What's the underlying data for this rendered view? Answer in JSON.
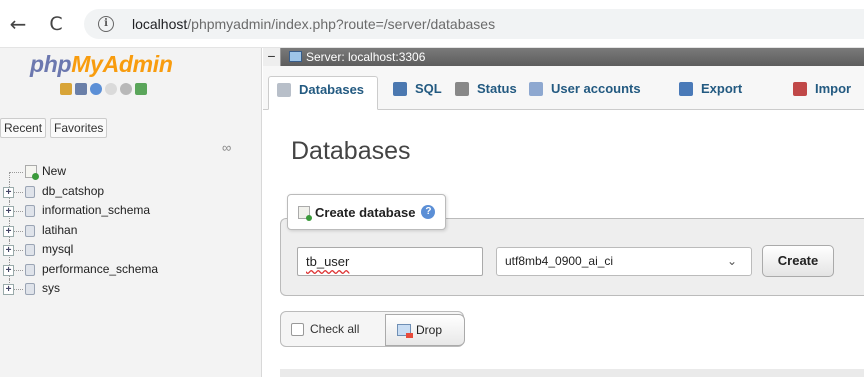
{
  "browser": {
    "back_glyph": "←",
    "reload_glyph": "C",
    "info_glyph": "i",
    "url_host": "localhost",
    "url_path": "/phpmyadmin/index.php?route=/server/databases"
  },
  "sidebar": {
    "logo_part1": "php",
    "logo_part2": "MyAdmin",
    "tabs": [
      "Recent",
      "Favorites"
    ],
    "link_glyph": "∞",
    "new_label": "New",
    "databases": [
      "db_catshop",
      "information_schema",
      "latihan",
      "mysql",
      "performance_schema",
      "sys"
    ],
    "expand_glyph": "+"
  },
  "server_bar": {
    "collapse_glyph": "−",
    "label": "Server: localhost:3306"
  },
  "menu": {
    "items": [
      {
        "label": "Databases",
        "icon": "database-icon",
        "color": "#9aa"
      },
      {
        "label": "SQL",
        "icon": "sql-icon",
        "color": "#4b78b0"
      },
      {
        "label": "Status",
        "icon": "status-icon",
        "color": "#777"
      },
      {
        "label": "User accounts",
        "icon": "users-icon",
        "color": "#6b8cc0"
      },
      {
        "label": "Export",
        "icon": "export-icon",
        "color": "#4a7ab8"
      },
      {
        "label": "Impor",
        "icon": "import-icon",
        "color": "#c04848"
      }
    ]
  },
  "page": {
    "title": "Databases"
  },
  "create": {
    "legend": "Create database",
    "help_glyph": "?",
    "db_name_value": "tb_user",
    "collation": "utf8mb4_0900_ai_ci",
    "dropdown_glyph": "⌄",
    "button": "Create"
  },
  "bulk": {
    "check_all": "Check all",
    "drop": "Drop"
  }
}
